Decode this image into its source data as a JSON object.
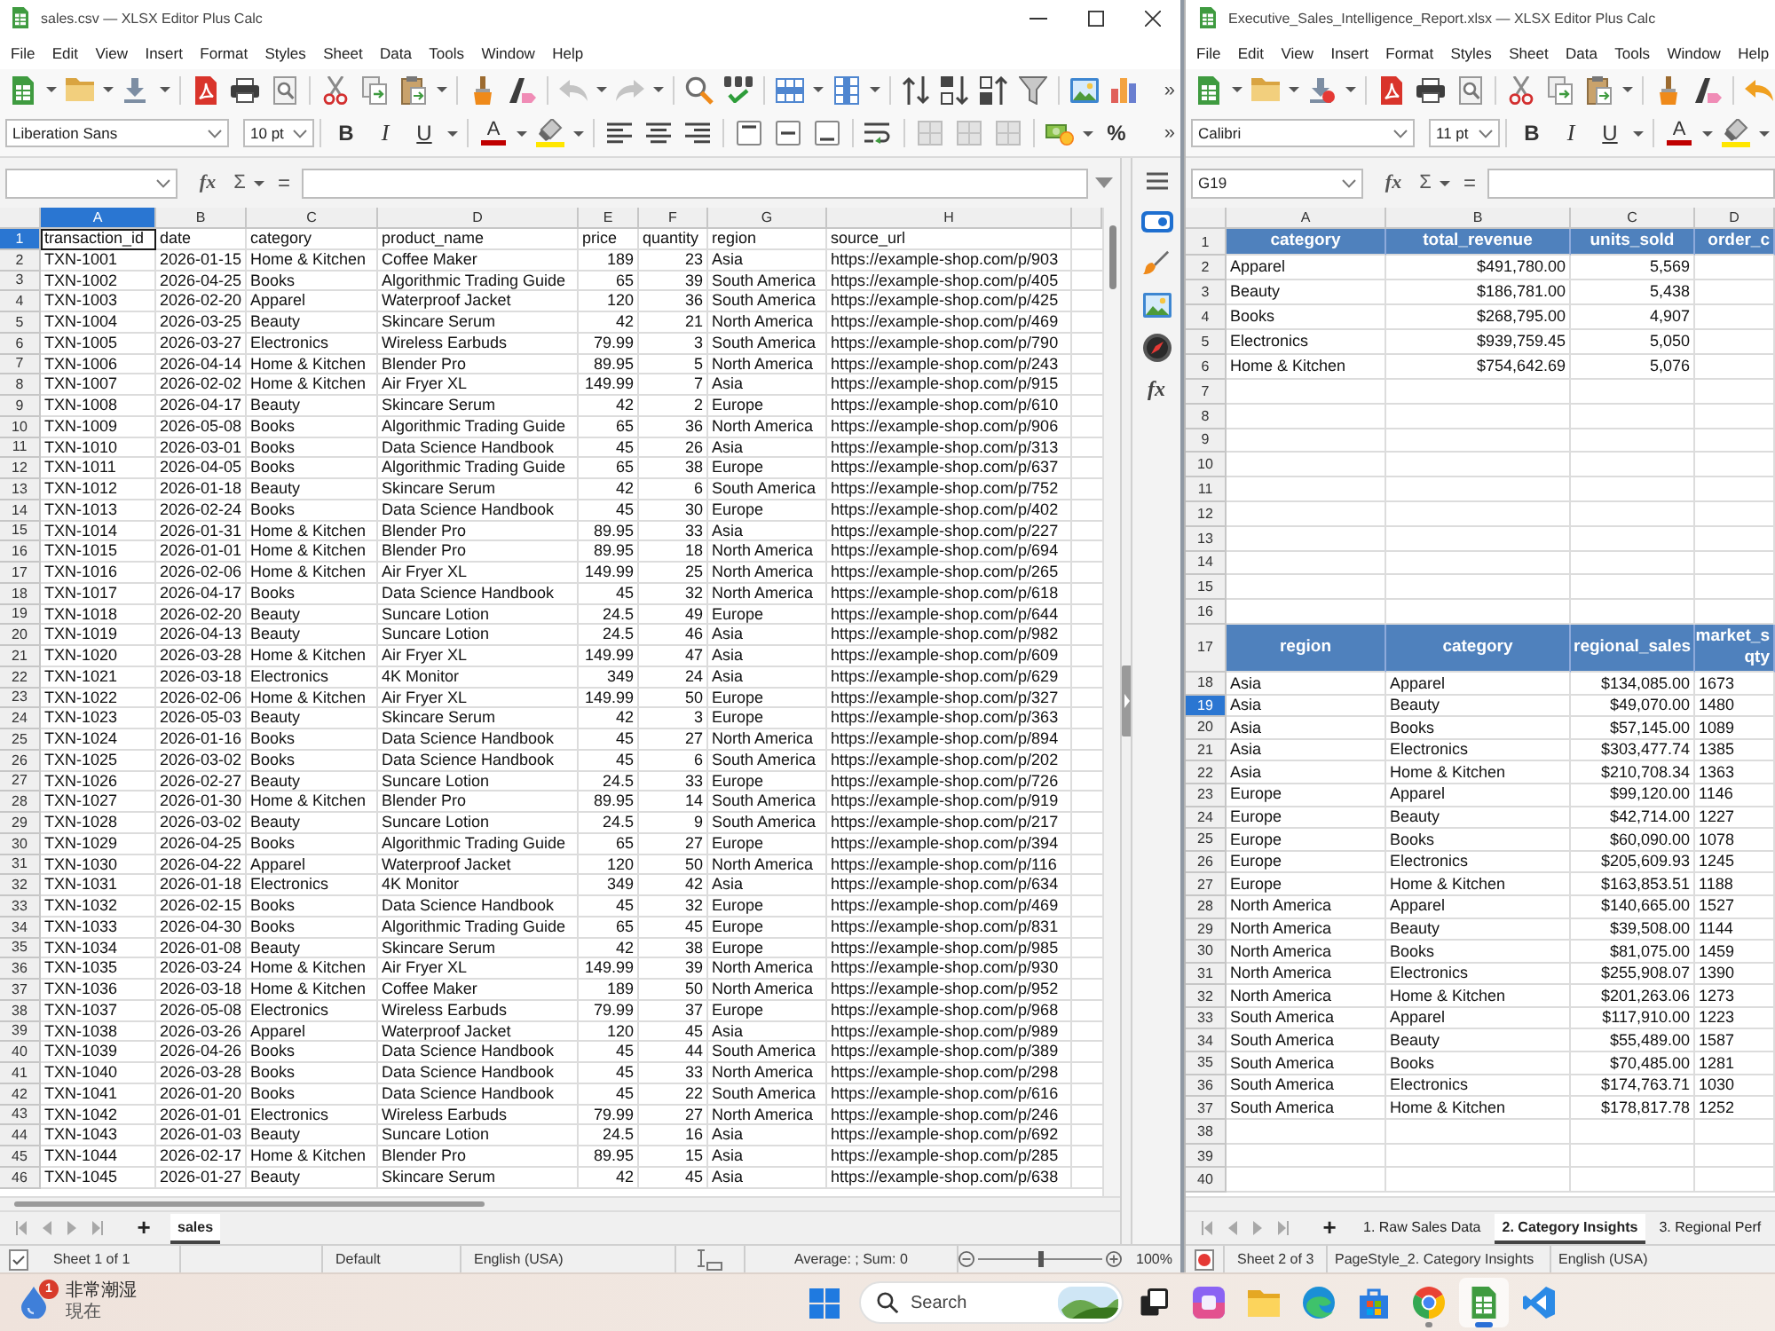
{
  "windows": [
    {
      "title": "sales.csv — XLSX Editor Plus Calc",
      "document_modified": false,
      "menu": [
        "File",
        "Edit",
        "View",
        "Insert",
        "Format",
        "Styles",
        "Sheet",
        "Data",
        "Tools",
        "Window",
        "Help"
      ],
      "toolbar_1": {
        "more": "»"
      },
      "toolbar_2": {
        "font_name": "Liberation Sans",
        "font_size": "10 pt",
        "bold": "B",
        "italic": "I",
        "underline": "U",
        "font_color": "A",
        "percent": "%",
        "more": "»"
      },
      "formula_bar": {
        "function_wizard": "fx",
        "sum": "Σ",
        "equals": "="
      },
      "sidebar": {
        "functions": "fx"
      },
      "columns": [
        {
          "letter": "A",
          "selected": true
        },
        {
          "letter": "B",
          "selected": false
        },
        {
          "letter": "C",
          "selected": false
        },
        {
          "letter": "D",
          "selected": false
        },
        {
          "letter": "E",
          "selected": false
        },
        {
          "letter": "F",
          "selected": false
        },
        {
          "letter": "G",
          "selected": false
        },
        {
          "letter": "H",
          "selected": false
        }
      ],
      "rows": [
        {
          "number": "1",
          "selected": true,
          "kind": "label",
          "cells": [
            "transaction_id",
            "date",
            "category",
            "product_name",
            "price",
            "quantity",
            "region",
            "source_url"
          ]
        },
        {
          "number": "2",
          "selected": false,
          "kind": "data",
          "cells": [
            "TXN-1001",
            "2026-01-15",
            "Home & Kitchen",
            "Coffee Maker",
            "189",
            "23",
            "Asia",
            "https://example-shop.com/p/903"
          ]
        },
        {
          "number": "3",
          "selected": false,
          "kind": "data",
          "cells": [
            "TXN-1002",
            "2026-04-25",
            "Books",
            "Algorithmic Trading Guide",
            "65",
            "39",
            "South America",
            "https://example-shop.com/p/405"
          ]
        },
        {
          "number": "4",
          "selected": false,
          "kind": "data",
          "cells": [
            "TXN-1003",
            "2026-02-20",
            "Apparel",
            "Waterproof Jacket",
            "120",
            "36",
            "South America",
            "https://example-shop.com/p/425"
          ]
        },
        {
          "number": "5",
          "selected": false,
          "kind": "data",
          "cells": [
            "TXN-1004",
            "2026-03-25",
            "Beauty",
            "Skincare Serum",
            "42",
            "21",
            "North America",
            "https://example-shop.com/p/469"
          ]
        },
        {
          "number": "6",
          "selected": false,
          "kind": "data",
          "cells": [
            "TXN-1005",
            "2026-03-27",
            "Electronics",
            "Wireless Earbuds",
            "79.99",
            "3",
            "South America",
            "https://example-shop.com/p/790"
          ]
        },
        {
          "number": "7",
          "selected": false,
          "kind": "data",
          "cells": [
            "TXN-1006",
            "2026-04-14",
            "Home & Kitchen",
            "Blender Pro",
            "89.95",
            "5",
            "North America",
            "https://example-shop.com/p/243"
          ]
        },
        {
          "number": "8",
          "selected": false,
          "kind": "data",
          "cells": [
            "TXN-1007",
            "2026-02-02",
            "Home & Kitchen",
            "Air Fryer XL",
            "149.99",
            "7",
            "Asia",
            "https://example-shop.com/p/915"
          ]
        },
        {
          "number": "9",
          "selected": false,
          "kind": "data",
          "cells": [
            "TXN-1008",
            "2026-04-17",
            "Beauty",
            "Skincare Serum",
            "42",
            "2",
            "Europe",
            "https://example-shop.com/p/610"
          ]
        },
        {
          "number": "10",
          "selected": false,
          "kind": "data",
          "cells": [
            "TXN-1009",
            "2026-05-08",
            "Books",
            "Algorithmic Trading Guide",
            "65",
            "36",
            "North America",
            "https://example-shop.com/p/906"
          ]
        },
        {
          "number": "11",
          "selected": false,
          "kind": "data",
          "cells": [
            "TXN-1010",
            "2026-03-01",
            "Books",
            "Data Science Handbook",
            "45",
            "26",
            "Asia",
            "https://example-shop.com/p/313"
          ]
        },
        {
          "number": "12",
          "selected": false,
          "kind": "data",
          "cells": [
            "TXN-1011",
            "2026-04-05",
            "Books",
            "Algorithmic Trading Guide",
            "65",
            "38",
            "Europe",
            "https://example-shop.com/p/637"
          ]
        },
        {
          "number": "13",
          "selected": false,
          "kind": "data",
          "cells": [
            "TXN-1012",
            "2026-01-18",
            "Beauty",
            "Skincare Serum",
            "42",
            "6",
            "South America",
            "https://example-shop.com/p/752"
          ]
        },
        {
          "number": "14",
          "selected": false,
          "kind": "data",
          "cells": [
            "TXN-1013",
            "2026-02-24",
            "Books",
            "Data Science Handbook",
            "45",
            "30",
            "Europe",
            "https://example-shop.com/p/402"
          ]
        },
        {
          "number": "15",
          "selected": false,
          "kind": "data",
          "cells": [
            "TXN-1014",
            "2026-01-31",
            "Home & Kitchen",
            "Blender Pro",
            "89.95",
            "33",
            "Asia",
            "https://example-shop.com/p/227"
          ]
        },
        {
          "number": "16",
          "selected": false,
          "kind": "data",
          "cells": [
            "TXN-1015",
            "2026-01-01",
            "Home & Kitchen",
            "Blender Pro",
            "89.95",
            "18",
            "North America",
            "https://example-shop.com/p/694"
          ]
        },
        {
          "number": "17",
          "selected": false,
          "kind": "data",
          "cells": [
            "TXN-1016",
            "2026-02-06",
            "Home & Kitchen",
            "Air Fryer XL",
            "149.99",
            "25",
            "North America",
            "https://example-shop.com/p/265"
          ]
        },
        {
          "number": "18",
          "selected": false,
          "kind": "data",
          "cells": [
            "TXN-1017",
            "2026-04-17",
            "Books",
            "Data Science Handbook",
            "45",
            "32",
            "North America",
            "https://example-shop.com/p/618"
          ]
        },
        {
          "number": "19",
          "selected": false,
          "kind": "data",
          "cells": [
            "TXN-1018",
            "2026-02-20",
            "Beauty",
            "Suncare Lotion",
            "24.5",
            "49",
            "Europe",
            "https://example-shop.com/p/644"
          ]
        },
        {
          "number": "20",
          "selected": false,
          "kind": "data",
          "cells": [
            "TXN-1019",
            "2026-04-13",
            "Beauty",
            "Suncare Lotion",
            "24.5",
            "46",
            "Asia",
            "https://example-shop.com/p/982"
          ]
        },
        {
          "number": "21",
          "selected": false,
          "kind": "data",
          "cells": [
            "TXN-1020",
            "2026-03-28",
            "Home & Kitchen",
            "Air Fryer XL",
            "149.99",
            "47",
            "Asia",
            "https://example-shop.com/p/609"
          ]
        },
        {
          "number": "22",
          "selected": false,
          "kind": "data",
          "cells": [
            "TXN-1021",
            "2026-03-18",
            "Electronics",
            "4K Monitor",
            "349",
            "24",
            "Asia",
            "https://example-shop.com/p/629"
          ]
        },
        {
          "number": "23",
          "selected": false,
          "kind": "data",
          "cells": [
            "TXN-1022",
            "2026-02-06",
            "Home & Kitchen",
            "Air Fryer XL",
            "149.99",
            "50",
            "Europe",
            "https://example-shop.com/p/327"
          ]
        },
        {
          "number": "24",
          "selected": false,
          "kind": "data",
          "cells": [
            "TXN-1023",
            "2026-05-03",
            "Beauty",
            "Skincare Serum",
            "42",
            "3",
            "Europe",
            "https://example-shop.com/p/363"
          ]
        },
        {
          "number": "25",
          "selected": false,
          "kind": "data",
          "cells": [
            "TXN-1024",
            "2026-01-16",
            "Books",
            "Data Science Handbook",
            "45",
            "27",
            "North America",
            "https://example-shop.com/p/894"
          ]
        },
        {
          "number": "26",
          "selected": false,
          "kind": "data",
          "cells": [
            "TXN-1025",
            "2026-03-02",
            "Books",
            "Data Science Handbook",
            "45",
            "6",
            "South America",
            "https://example-shop.com/p/202"
          ]
        },
        {
          "number": "27",
          "selected": false,
          "kind": "data",
          "cells": [
            "TXN-1026",
            "2026-02-27",
            "Beauty",
            "Suncare Lotion",
            "24.5",
            "33",
            "Europe",
            "https://example-shop.com/p/726"
          ]
        },
        {
          "number": "28",
          "selected": false,
          "kind": "data",
          "cells": [
            "TXN-1027",
            "2026-01-30",
            "Home & Kitchen",
            "Blender Pro",
            "89.95",
            "14",
            "South America",
            "https://example-shop.com/p/919"
          ]
        },
        {
          "number": "29",
          "selected": false,
          "kind": "data",
          "cells": [
            "TXN-1028",
            "2026-03-02",
            "Beauty",
            "Suncare Lotion",
            "24.5",
            "9",
            "South America",
            "https://example-shop.com/p/217"
          ]
        },
        {
          "number": "30",
          "selected": false,
          "kind": "data",
          "cells": [
            "TXN-1029",
            "2026-04-25",
            "Books",
            "Algorithmic Trading Guide",
            "65",
            "27",
            "Europe",
            "https://example-shop.com/p/394"
          ]
        },
        {
          "number": "31",
          "selected": false,
          "kind": "data",
          "cells": [
            "TXN-1030",
            "2026-04-22",
            "Apparel",
            "Waterproof Jacket",
            "120",
            "50",
            "North America",
            "https://example-shop.com/p/116"
          ]
        },
        {
          "number": "32",
          "selected": false,
          "kind": "data",
          "cells": [
            "TXN-1031",
            "2026-01-18",
            "Electronics",
            "4K Monitor",
            "349",
            "42",
            "Asia",
            "https://example-shop.com/p/634"
          ]
        },
        {
          "number": "33",
          "selected": false,
          "kind": "data",
          "cells": [
            "TXN-1032",
            "2026-02-15",
            "Books",
            "Data Science Handbook",
            "45",
            "32",
            "Europe",
            "https://example-shop.com/p/469"
          ]
        },
        {
          "number": "34",
          "selected": false,
          "kind": "data",
          "cells": [
            "TXN-1033",
            "2026-04-30",
            "Books",
            "Algorithmic Trading Guide",
            "65",
            "45",
            "Europe",
            "https://example-shop.com/p/831"
          ]
        },
        {
          "number": "35",
          "selected": false,
          "kind": "data",
          "cells": [
            "TXN-1034",
            "2026-01-08",
            "Beauty",
            "Skincare Serum",
            "42",
            "38",
            "Europe",
            "https://example-shop.com/p/985"
          ]
        },
        {
          "number": "36",
          "selected": false,
          "kind": "data",
          "cells": [
            "TXN-1035",
            "2026-03-24",
            "Home & Kitchen",
            "Air Fryer XL",
            "149.99",
            "39",
            "North America",
            "https://example-shop.com/p/930"
          ]
        },
        {
          "number": "37",
          "selected": false,
          "kind": "data",
          "cells": [
            "TXN-1036",
            "2026-03-18",
            "Home & Kitchen",
            "Coffee Maker",
            "189",
            "50",
            "North America",
            "https://example-shop.com/p/952"
          ]
        },
        {
          "number": "38",
          "selected": false,
          "kind": "data",
          "cells": [
            "TXN-1037",
            "2026-05-08",
            "Electronics",
            "Wireless Earbuds",
            "79.99",
            "37",
            "Europe",
            "https://example-shop.com/p/968"
          ]
        },
        {
          "number": "39",
          "selected": false,
          "kind": "data",
          "cells": [
            "TXN-1038",
            "2026-03-26",
            "Apparel",
            "Waterproof Jacket",
            "120",
            "45",
            "Asia",
            "https://example-shop.com/p/989"
          ]
        },
        {
          "number": "40",
          "selected": false,
          "kind": "data",
          "cells": [
            "TXN-1039",
            "2026-04-26",
            "Books",
            "Data Science Handbook",
            "45",
            "44",
            "South America",
            "https://example-shop.com/p/389"
          ]
        },
        {
          "number": "41",
          "selected": false,
          "kind": "data",
          "cells": [
            "TXN-1040",
            "2026-03-28",
            "Books",
            "Data Science Handbook",
            "45",
            "33",
            "North America",
            "https://example-shop.com/p/298"
          ]
        },
        {
          "number": "42",
          "selected": false,
          "kind": "data",
          "cells": [
            "TXN-1041",
            "2026-01-20",
            "Books",
            "Data Science Handbook",
            "45",
            "22",
            "South America",
            "https://example-shop.com/p/616"
          ]
        },
        {
          "number": "43",
          "selected": false,
          "kind": "data",
          "cells": [
            "TXN-1042",
            "2026-01-01",
            "Electronics",
            "Wireless Earbuds",
            "79.99",
            "27",
            "North America",
            "https://example-shop.com/p/246"
          ]
        },
        {
          "number": "44",
          "selected": false,
          "kind": "data",
          "cells": [
            "TXN-1043",
            "2026-01-03",
            "Beauty",
            "Suncare Lotion",
            "24.5",
            "16",
            "Asia",
            "https://example-shop.com/p/692"
          ]
        },
        {
          "number": "45",
          "selected": false,
          "kind": "data",
          "cells": [
            "TXN-1044",
            "2026-02-17",
            "Home & Kitchen",
            "Blender Pro",
            "89.95",
            "15",
            "Asia",
            "https://example-shop.com/p/285"
          ]
        },
        {
          "number": "46",
          "selected": false,
          "kind": "data",
          "cells": [
            "TXN-1045",
            "2026-01-27",
            "Beauty",
            "Skincare Serum",
            "42",
            "45",
            "Asia",
            "https://example-shop.com/p/638"
          ]
        }
      ],
      "sheet_tabs": {
        "add": "+",
        "tabs": [
          {
            "label": "sales",
            "selected": true
          }
        ]
      },
      "status_bar": {
        "sheet": "Sheet 1 of 1",
        "page_style": "Default",
        "language": "English (USA)",
        "selection": "Average: ; Sum: 0",
        "zoom_slider": {
          "level": 0.5
        },
        "zoom": "100%"
      }
    },
    {
      "title": "Executive_Sales_Intelligence_Report.xlsx — XLSX Editor Plus Calc",
      "document_modified": true,
      "menu": [
        "File",
        "Edit",
        "View",
        "Insert",
        "Format",
        "Styles",
        "Sheet",
        "Data",
        "Tools",
        "Window",
        "Help"
      ],
      "toolbar_2": {
        "font_name": "Calibri",
        "font_size": "11 pt",
        "bold": "B",
        "italic": "I",
        "underline": "U",
        "font_color": "A"
      },
      "formula_bar": {
        "name_box": "G19",
        "function_wizard": "fx",
        "sum": "Σ",
        "equals": "="
      },
      "columns": [
        {
          "letter": "A",
          "selected": false
        },
        {
          "letter": "B",
          "selected": false
        },
        {
          "letter": "C",
          "selected": false
        },
        {
          "letter": "D",
          "selected": false
        }
      ],
      "rows": [
        {
          "number": "1",
          "selected": false,
          "kind": "header",
          "cells": [
            "category",
            "total_revenue",
            "units_sold",
            "order_c"
          ]
        },
        {
          "number": "2",
          "selected": false,
          "kind": "summary",
          "cells": [
            "Apparel",
            "$491,780.00",
            "5,569"
          ]
        },
        {
          "number": "3",
          "selected": false,
          "kind": "summary",
          "cells": [
            "Beauty",
            "$186,781.00",
            "5,438"
          ]
        },
        {
          "number": "4",
          "selected": false,
          "kind": "summary",
          "cells": [
            "Books",
            "$268,795.00",
            "4,907"
          ]
        },
        {
          "number": "5",
          "selected": false,
          "kind": "summary",
          "cells": [
            "Electronics",
            "$939,759.45",
            "5,050"
          ]
        },
        {
          "number": "6",
          "selected": false,
          "kind": "summary",
          "cells": [
            "Home & Kitchen",
            "$754,642.69",
            "5,076"
          ]
        },
        {
          "number": "7",
          "selected": false,
          "kind": "blank"
        },
        {
          "number": "8",
          "selected": false,
          "kind": "blank"
        },
        {
          "number": "9",
          "selected": false,
          "kind": "blank"
        },
        {
          "number": "10",
          "selected": false,
          "kind": "blank"
        },
        {
          "number": "11",
          "selected": false,
          "kind": "blank"
        },
        {
          "number": "12",
          "selected": false,
          "kind": "blank"
        },
        {
          "number": "13",
          "selected": false,
          "kind": "blank"
        },
        {
          "number": "14",
          "selected": false,
          "kind": "blank"
        },
        {
          "number": "15",
          "selected": false,
          "kind": "blank"
        },
        {
          "number": "16",
          "selected": false,
          "kind": "blank"
        },
        {
          "number": "17",
          "selected": false,
          "kind": "header",
          "cells": [
            "region",
            "category",
            "regional_sales",
            "market_s\nqty"
          ]
        },
        {
          "number": "18",
          "selected": false,
          "kind": "detail",
          "cells": [
            "Asia",
            "Apparel",
            "$134,085.00",
            "1673"
          ]
        },
        {
          "number": "19",
          "selected": true,
          "kind": "detail",
          "cells": [
            "Asia",
            "Beauty",
            "$49,070.00",
            "1480"
          ]
        },
        {
          "number": "20",
          "selected": false,
          "kind": "detail",
          "cells": [
            "Asia",
            "Books",
            "$57,145.00",
            "1089"
          ]
        },
        {
          "number": "21",
          "selected": false,
          "kind": "detail",
          "cells": [
            "Asia",
            "Electronics",
            "$303,477.74",
            "1385"
          ]
        },
        {
          "number": "22",
          "selected": false,
          "kind": "detail",
          "cells": [
            "Asia",
            "Home & Kitchen",
            "$210,708.34",
            "1363"
          ]
        },
        {
          "number": "23",
          "selected": false,
          "kind": "detail",
          "cells": [
            "Europe",
            "Apparel",
            "$99,120.00",
            "1146"
          ]
        },
        {
          "number": "24",
          "selected": false,
          "kind": "detail",
          "cells": [
            "Europe",
            "Beauty",
            "$42,714.00",
            "1227"
          ]
        },
        {
          "number": "25",
          "selected": false,
          "kind": "detail",
          "cells": [
            "Europe",
            "Books",
            "$60,090.00",
            "1078"
          ]
        },
        {
          "number": "26",
          "selected": false,
          "kind": "detail",
          "cells": [
            "Europe",
            "Electronics",
            "$205,609.93",
            "1245"
          ]
        },
        {
          "number": "27",
          "selected": false,
          "kind": "detail",
          "cells": [
            "Europe",
            "Home & Kitchen",
            "$163,853.51",
            "1188"
          ]
        },
        {
          "number": "28",
          "selected": false,
          "kind": "detail",
          "cells": [
            "North America",
            "Apparel",
            "$140,665.00",
            "1527"
          ]
        },
        {
          "number": "29",
          "selected": false,
          "kind": "detail",
          "cells": [
            "North America",
            "Beauty",
            "$39,508.00",
            "1144"
          ]
        },
        {
          "number": "30",
          "selected": false,
          "kind": "detail",
          "cells": [
            "North America",
            "Books",
            "$81,075.00",
            "1459"
          ]
        },
        {
          "number": "31",
          "selected": false,
          "kind": "detail",
          "cells": [
            "North America",
            "Electronics",
            "$255,908.07",
            "1390"
          ]
        },
        {
          "number": "32",
          "selected": false,
          "kind": "detail",
          "cells": [
            "North America",
            "Home & Kitchen",
            "$201,263.06",
            "1273"
          ]
        },
        {
          "number": "33",
          "selected": false,
          "kind": "detail",
          "cells": [
            "South America",
            "Apparel",
            "$117,910.00",
            "1223"
          ]
        },
        {
          "number": "34",
          "selected": false,
          "kind": "detail",
          "cells": [
            "South America",
            "Beauty",
            "$55,489.00",
            "1587"
          ]
        },
        {
          "number": "35",
          "selected": false,
          "kind": "detail",
          "cells": [
            "South America",
            "Books",
            "$70,485.00",
            "1281"
          ]
        },
        {
          "number": "36",
          "selected": false,
          "kind": "detail",
          "cells": [
            "South America",
            "Electronics",
            "$174,763.71",
            "1030"
          ]
        },
        {
          "number": "37",
          "selected": false,
          "kind": "detail",
          "cells": [
            "South America",
            "Home & Kitchen",
            "$178,817.78",
            "1252"
          ]
        },
        {
          "number": "38",
          "selected": false,
          "kind": "blank"
        },
        {
          "number": "39",
          "selected": false,
          "kind": "blank"
        },
        {
          "number": "40",
          "selected": false,
          "kind": "blank"
        }
      ],
      "sheet_tabs": {
        "add": "+",
        "tabs": [
          {
            "label": "1. Raw Sales Data",
            "selected": false
          },
          {
            "label": "2. Category Insights",
            "selected": true
          },
          {
            "label": "3. Regional Perf",
            "selected": false
          }
        ]
      },
      "status_bar": {
        "sheet": "Sheet 2 of 3",
        "page_style": "PageStyle_2. Category Insights",
        "language": "English (USA)"
      }
    }
  ],
  "taskbar": {
    "notification": {
      "badge": "1",
      "title": "非常潮湿",
      "time": "現在"
    },
    "search": {
      "placeholder": "Search"
    },
    "apps": [
      {
        "kind": "taskview",
        "selected": false,
        "running": false
      },
      {
        "kind": "suite",
        "selected": false,
        "running": false
      },
      {
        "kind": "folder",
        "selected": false,
        "running": false
      },
      {
        "kind": "swirl",
        "selected": false,
        "running": false
      },
      {
        "kind": "bag",
        "selected": false,
        "running": false
      },
      {
        "kind": "ring",
        "selected": false,
        "running": true
      },
      {
        "kind": "sheet",
        "selected": true,
        "running": true
      },
      {
        "kind": "editor",
        "selected": false,
        "running": false
      }
    ]
  }
}
